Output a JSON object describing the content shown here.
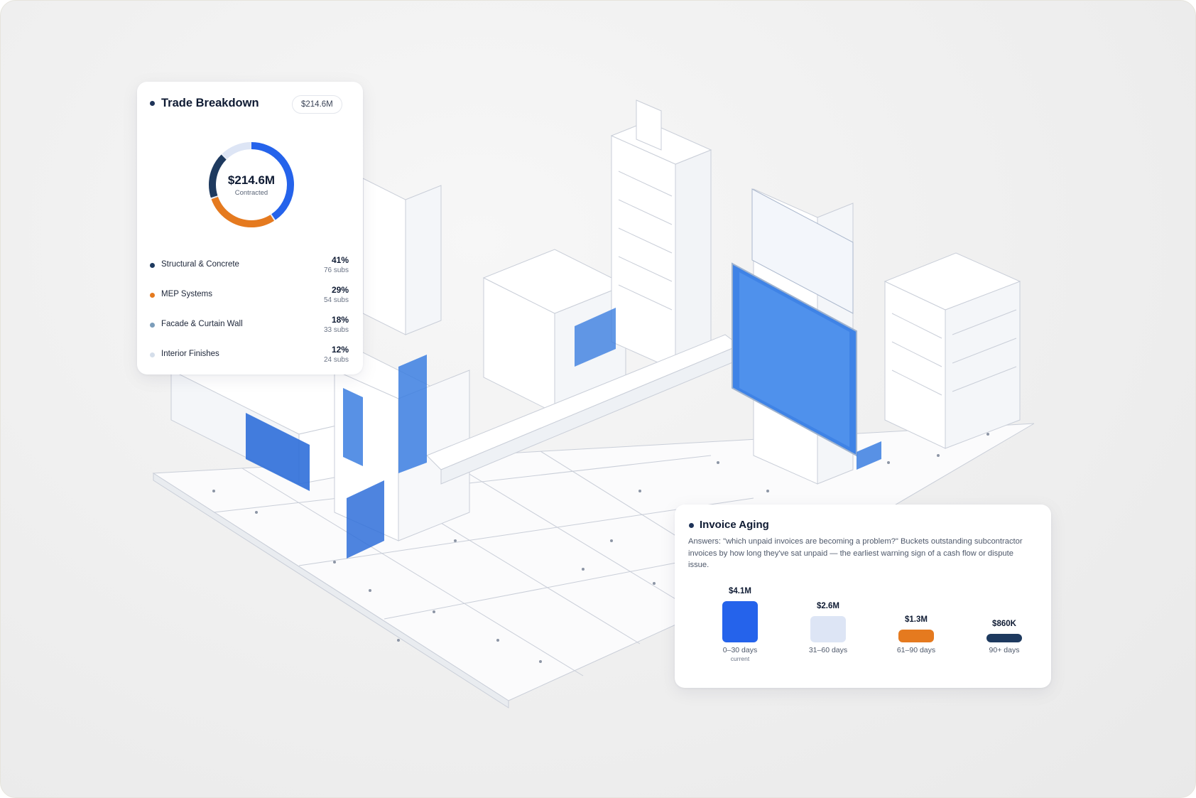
{
  "colors": {
    "navy": "#1e3a5f",
    "blue": "#2563eb",
    "orange": "#e57a1f",
    "steel": "#7c9dba",
    "pale": "#dde5f5",
    "ring_track": "#e6ebf5"
  },
  "trade_breakdown": {
    "title": "Trade Breakdown",
    "total_pill": "$214.6M",
    "donut_value": "$214.6M",
    "donut_label": "Contracted",
    "items": [
      {
        "name": "Structural & Concrete",
        "pct": "41%",
        "subs": "76 subs",
        "color": "#1e3a5f"
      },
      {
        "name": "MEP Systems",
        "pct": "29%",
        "subs": "54 subs",
        "color": "#e57a1f"
      },
      {
        "name": "Facade & Curtain Wall",
        "pct": "18%",
        "subs": "33 subs",
        "color": "#7c9dba"
      },
      {
        "name": "Interior Finishes",
        "pct": "12%",
        "subs": "24 subs",
        "color": "#d5deea"
      }
    ]
  },
  "invoice_aging": {
    "title": "Invoice Aging",
    "description": "Answers: \"which unpaid invoices are becoming a problem?\" Buckets outstanding subcontractor invoices by how long they've sat unpaid — the earliest warning sign of a cash flow or dispute issue."
  },
  "chart_data": [
    {
      "type": "pie",
      "title": "",
      "center_value": "$214.6M",
      "center_label": "Contracted",
      "categories": [
        "Structural & Concrete",
        "MEP Systems",
        "Facade & Curtain Wall",
        "Interior Finishes"
      ],
      "values": [
        41,
        29,
        18,
        12
      ],
      "segment_colors": [
        "#2563eb",
        "#e57a1f",
        "#1e3a5f",
        "#dde5f5"
      ]
    },
    {
      "type": "bar",
      "title": "",
      "categories": [
        "0–30 days",
        "31–60 days",
        "61–90 days",
        "90+ days"
      ],
      "category_sublabels": [
        "current",
        "",
        "",
        ""
      ],
      "values": [
        4.1,
        2.6,
        1.3,
        0.86
      ],
      "value_labels": [
        "$4.1M",
        "$2.6M",
        "$1.3M",
        "$860K"
      ],
      "unit": "$M",
      "colors": [
        "#2563eb",
        "#dde5f5",
        "#e57a1f",
        "#1e3a5f"
      ],
      "ylim": [
        0,
        4.1
      ],
      "grid": false,
      "legend": false
    }
  ]
}
